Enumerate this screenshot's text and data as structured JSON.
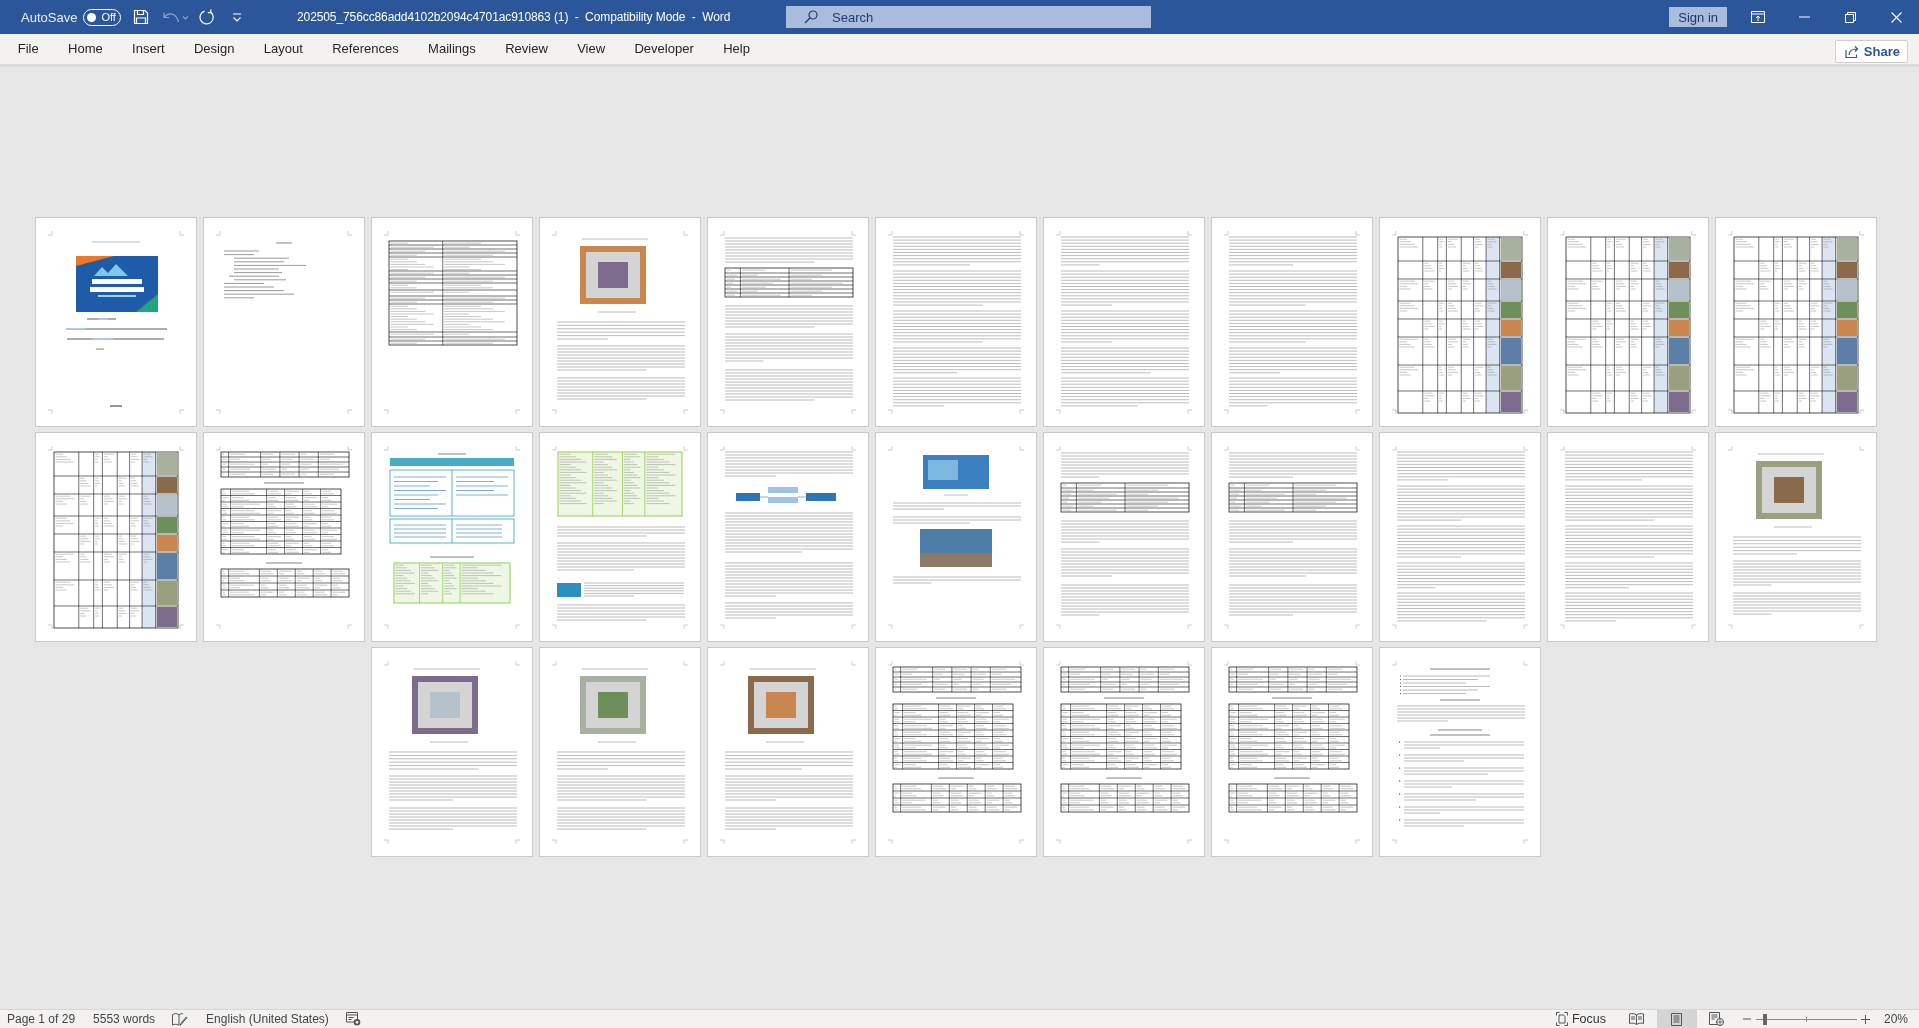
{
  "title_bar": {
    "autosave": {
      "label": "AutoSave",
      "toggle": {
        "text": "Off",
        "on": false
      }
    },
    "quick_access": [
      {
        "kind": "save",
        "disabled": false
      },
      {
        "kind": "undo",
        "disabled": true
      },
      {
        "kind": "redo",
        "disabled": false
      },
      {
        "kind": "customize",
        "disabled": false
      }
    ],
    "title": "202505_756cc86add4102b2094c4701ac910863 (1)  -  Compatibility Mode  -  Word",
    "search": {
      "placeholder": "Search"
    },
    "sign_in": "Sign in",
    "window_controls": [
      {
        "kind": "ribbon-display"
      },
      {
        "kind": "minimize"
      },
      {
        "kind": "restore"
      },
      {
        "kind": "close"
      }
    ]
  },
  "ribbon": {
    "tabs": [
      {
        "label": "File",
        "selected": false
      },
      {
        "label": "Home",
        "selected": false
      },
      {
        "label": "Insert",
        "selected": false
      },
      {
        "label": "Design",
        "selected": false
      },
      {
        "label": "Layout",
        "selected": false
      },
      {
        "label": "References",
        "selected": false
      },
      {
        "label": "Mailings",
        "selected": false
      },
      {
        "label": "Review",
        "selected": false
      },
      {
        "label": "View",
        "selected": false
      },
      {
        "label": "Developer",
        "selected": false
      },
      {
        "label": "Help",
        "selected": false
      }
    ],
    "share": "Share"
  },
  "document": {
    "pages": [
      {
        "kind": "cover"
      },
      {
        "kind": "contents"
      },
      {
        "kind": "form"
      },
      {
        "kind": "photo-text"
      },
      {
        "kind": "text-table"
      },
      {
        "kind": "text"
      },
      {
        "kind": "text"
      },
      {
        "kind": "text"
      },
      {
        "kind": "photo-grid"
      },
      {
        "kind": "photo-grid"
      },
      {
        "kind": "photo-grid"
      },
      {
        "kind": "photo-grid"
      },
      {
        "kind": "tables"
      },
      {
        "kind": "boxes"
      },
      {
        "kind": "green-table"
      },
      {
        "kind": "diagram"
      },
      {
        "kind": "photos"
      },
      {
        "kind": "text-table"
      },
      {
        "kind": "text-table"
      },
      {
        "kind": "text"
      },
      {
        "kind": "text"
      },
      {
        "kind": "photo-text"
      },
      {
        "kind": "photo-text"
      },
      {
        "kind": "photo-text"
      },
      {
        "kind": "photo-text"
      },
      {
        "kind": "tables"
      },
      {
        "kind": "tables"
      },
      {
        "kind": "tables"
      },
      {
        "kind": "list"
      }
    ]
  },
  "status_bar": {
    "page": "Page 1 of 29",
    "words": "5553 words",
    "language": "English (United States)",
    "focus": "Focus",
    "views": [
      {
        "kind": "read",
        "selected": false
      },
      {
        "kind": "print",
        "selected": true
      },
      {
        "kind": "web",
        "selected": false
      }
    ],
    "zoom_slider": {
      "level": 0.09
    },
    "zoom": "20%"
  }
}
